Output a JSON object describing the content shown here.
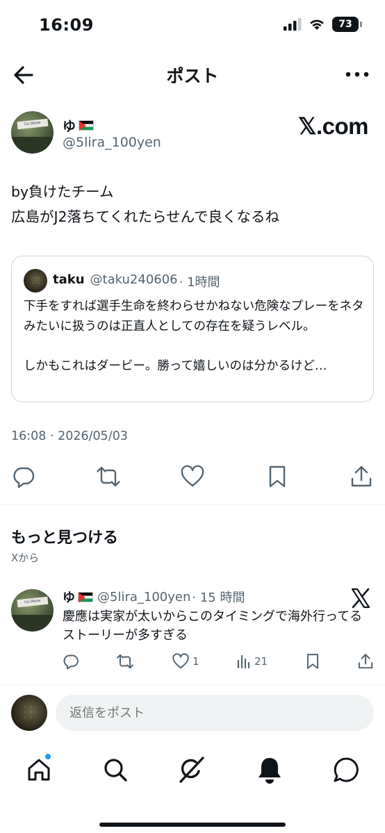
{
  "status_bar": {
    "time": "16:09",
    "battery": "73"
  },
  "header": {
    "title": "ポスト",
    "icons": [
      "back-arrow-icon",
      "more-icon"
    ]
  },
  "post": {
    "author_name": "ゆ",
    "author_handle": "@5lira_100yen",
    "watermark": "𝕏.com",
    "text_lines": [
      "by負けたチーム",
      "広島がJ2落ちてくれたらせんで良くなるね"
    ],
    "timestamp": "16:08 · 2026/05/03"
  },
  "quote": {
    "name": "taku",
    "handle": "@taku240606",
    "time": "· 1時間",
    "text": "下手をすれば選手生命を終わらせかねない危険なプレーをネタみたいに扱うのは正直人としての存在を疑うレベル。\n\nしかもこれはダービー。勝って嬉しいのは分かるけど…"
  },
  "actions": [
    "reply-icon",
    "repost-icon",
    "like-icon",
    "bookmark-icon",
    "share-icon"
  ],
  "discover": {
    "title": "もっと見つける",
    "subtitle": "Xから",
    "recommended": {
      "name": "ゆ",
      "handle": "@5lira_100yen",
      "time": "· 15 時間",
      "text": "慶應は実家が太いからこのタイミングで海外行ってるストーリーが多すぎる",
      "likes": "1",
      "views": "21"
    }
  },
  "reply": {
    "placeholder": "返信をポスト"
  },
  "tabbar": [
    "home-icon",
    "search-icon",
    "grok-icon",
    "notifications-icon",
    "messages-icon"
  ],
  "colors": {
    "text": "#0f1419",
    "secondary": "#536471",
    "accent": "#1d9bf0",
    "border": "#cfd9de"
  }
}
